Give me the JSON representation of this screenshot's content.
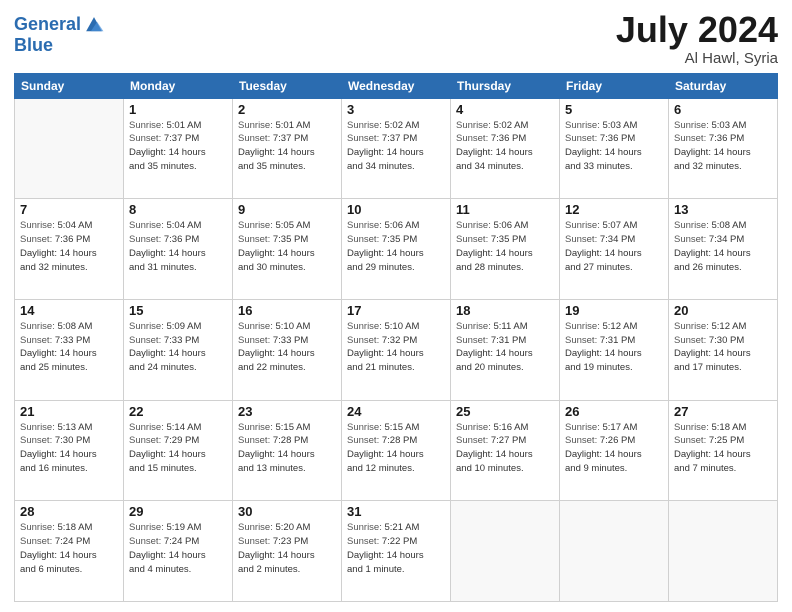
{
  "header": {
    "logo_line1": "General",
    "logo_line2": "Blue",
    "month_year": "July 2024",
    "location": "Al Hawl, Syria"
  },
  "days_of_week": [
    "Sunday",
    "Monday",
    "Tuesday",
    "Wednesday",
    "Thursday",
    "Friday",
    "Saturday"
  ],
  "weeks": [
    [
      {
        "day": "",
        "sunrise": "",
        "sunset": "",
        "daylight": ""
      },
      {
        "day": "1",
        "sunrise": "5:01 AM",
        "sunset": "7:37 PM",
        "daylight": "14 hours and 35 minutes."
      },
      {
        "day": "2",
        "sunrise": "5:01 AM",
        "sunset": "7:37 PM",
        "daylight": "14 hours and 35 minutes."
      },
      {
        "day": "3",
        "sunrise": "5:02 AM",
        "sunset": "7:37 PM",
        "daylight": "14 hours and 34 minutes."
      },
      {
        "day": "4",
        "sunrise": "5:02 AM",
        "sunset": "7:36 PM",
        "daylight": "14 hours and 34 minutes."
      },
      {
        "day": "5",
        "sunrise": "5:03 AM",
        "sunset": "7:36 PM",
        "daylight": "14 hours and 33 minutes."
      },
      {
        "day": "6",
        "sunrise": "5:03 AM",
        "sunset": "7:36 PM",
        "daylight": "14 hours and 32 minutes."
      }
    ],
    [
      {
        "day": "7",
        "sunrise": "5:04 AM",
        "sunset": "7:36 PM",
        "daylight": "14 hours and 32 minutes."
      },
      {
        "day": "8",
        "sunrise": "5:04 AM",
        "sunset": "7:36 PM",
        "daylight": "14 hours and 31 minutes."
      },
      {
        "day": "9",
        "sunrise": "5:05 AM",
        "sunset": "7:35 PM",
        "daylight": "14 hours and 30 minutes."
      },
      {
        "day": "10",
        "sunrise": "5:06 AM",
        "sunset": "7:35 PM",
        "daylight": "14 hours and 29 minutes."
      },
      {
        "day": "11",
        "sunrise": "5:06 AM",
        "sunset": "7:35 PM",
        "daylight": "14 hours and 28 minutes."
      },
      {
        "day": "12",
        "sunrise": "5:07 AM",
        "sunset": "7:34 PM",
        "daylight": "14 hours and 27 minutes."
      },
      {
        "day": "13",
        "sunrise": "5:08 AM",
        "sunset": "7:34 PM",
        "daylight": "14 hours and 26 minutes."
      }
    ],
    [
      {
        "day": "14",
        "sunrise": "5:08 AM",
        "sunset": "7:33 PM",
        "daylight": "14 hours and 25 minutes."
      },
      {
        "day": "15",
        "sunrise": "5:09 AM",
        "sunset": "7:33 PM",
        "daylight": "14 hours and 24 minutes."
      },
      {
        "day": "16",
        "sunrise": "5:10 AM",
        "sunset": "7:33 PM",
        "daylight": "14 hours and 22 minutes."
      },
      {
        "day": "17",
        "sunrise": "5:10 AM",
        "sunset": "7:32 PM",
        "daylight": "14 hours and 21 minutes."
      },
      {
        "day": "18",
        "sunrise": "5:11 AM",
        "sunset": "7:31 PM",
        "daylight": "14 hours and 20 minutes."
      },
      {
        "day": "19",
        "sunrise": "5:12 AM",
        "sunset": "7:31 PM",
        "daylight": "14 hours and 19 minutes."
      },
      {
        "day": "20",
        "sunrise": "5:12 AM",
        "sunset": "7:30 PM",
        "daylight": "14 hours and 17 minutes."
      }
    ],
    [
      {
        "day": "21",
        "sunrise": "5:13 AM",
        "sunset": "7:30 PM",
        "daylight": "14 hours and 16 minutes."
      },
      {
        "day": "22",
        "sunrise": "5:14 AM",
        "sunset": "7:29 PM",
        "daylight": "14 hours and 15 minutes."
      },
      {
        "day": "23",
        "sunrise": "5:15 AM",
        "sunset": "7:28 PM",
        "daylight": "14 hours and 13 minutes."
      },
      {
        "day": "24",
        "sunrise": "5:15 AM",
        "sunset": "7:28 PM",
        "daylight": "14 hours and 12 minutes."
      },
      {
        "day": "25",
        "sunrise": "5:16 AM",
        "sunset": "7:27 PM",
        "daylight": "14 hours and 10 minutes."
      },
      {
        "day": "26",
        "sunrise": "5:17 AM",
        "sunset": "7:26 PM",
        "daylight": "14 hours and 9 minutes."
      },
      {
        "day": "27",
        "sunrise": "5:18 AM",
        "sunset": "7:25 PM",
        "daylight": "14 hours and 7 minutes."
      }
    ],
    [
      {
        "day": "28",
        "sunrise": "5:18 AM",
        "sunset": "7:24 PM",
        "daylight": "14 hours and 6 minutes."
      },
      {
        "day": "29",
        "sunrise": "5:19 AM",
        "sunset": "7:24 PM",
        "daylight": "14 hours and 4 minutes."
      },
      {
        "day": "30",
        "sunrise": "5:20 AM",
        "sunset": "7:23 PM",
        "daylight": "14 hours and 2 minutes."
      },
      {
        "day": "31",
        "sunrise": "5:21 AM",
        "sunset": "7:22 PM",
        "daylight": "14 hours and 1 minute."
      },
      {
        "day": "",
        "sunrise": "",
        "sunset": "",
        "daylight": ""
      },
      {
        "day": "",
        "sunrise": "",
        "sunset": "",
        "daylight": ""
      },
      {
        "day": "",
        "sunrise": "",
        "sunset": "",
        "daylight": ""
      }
    ]
  ],
  "labels": {
    "sunrise": "Sunrise:",
    "sunset": "Sunset:",
    "daylight": "Daylight:"
  }
}
